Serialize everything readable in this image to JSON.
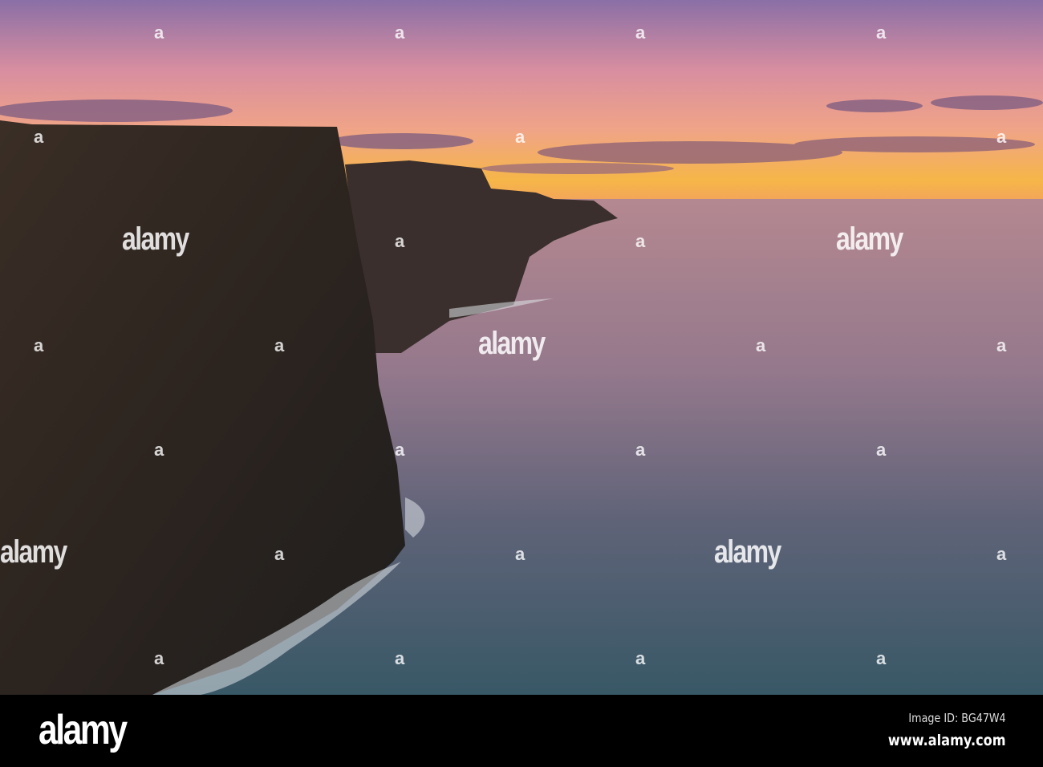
{
  "photo": {
    "subject": "Sea cliffs at sunset",
    "colors": {
      "sky_top": "#8a6fa6",
      "sky_mid": "#e8939c",
      "sky_glow": "#f6b648",
      "sea_far": "#b48890",
      "sea_near": "#385866",
      "cliff": "#2c241f"
    }
  },
  "watermark": {
    "text": "alamy",
    "mark": "a"
  },
  "footer": {
    "logo": "alamy",
    "image_id": "Image ID: BG47W4",
    "website": "www.alamy.com"
  }
}
